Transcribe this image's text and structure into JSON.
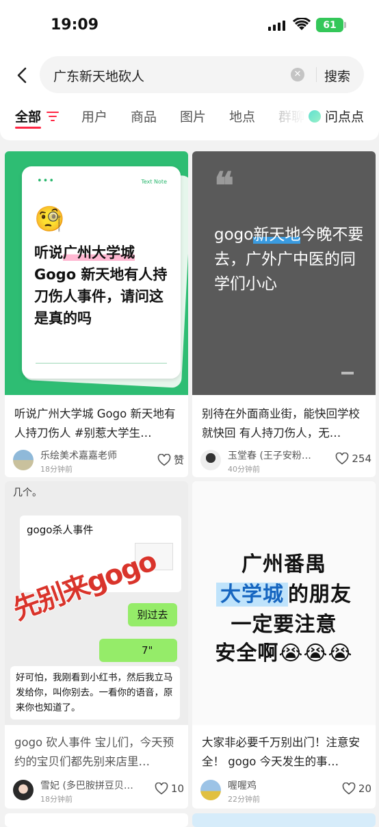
{
  "status_bar": {
    "time": "19:09",
    "battery": "61"
  },
  "search": {
    "query": "广东新天地砍人",
    "button": "搜索"
  },
  "tabs": [
    {
      "label": "全部"
    },
    {
      "label": "用户"
    },
    {
      "label": "商品"
    },
    {
      "label": "图片"
    },
    {
      "label": "地点"
    },
    {
      "label": "群聊"
    }
  ],
  "ask_button": "问点点",
  "accent_color": "#ff2442",
  "posts": [
    {
      "image": {
        "note_label": "Text Note",
        "emoji": "🧐",
        "text_before": "听说",
        "text_highlight": "广州大学城",
        "text_after": "Gogo 新天地有人持刀伤人事件，请问这是真的吗"
      },
      "title": "听说广州大学城 Gogo 新天地有人持刀伤人 #别惹大学生…",
      "author": "乐绘美术嘉嘉老师",
      "time": "18分钟前",
      "likes": "赞"
    },
    {
      "image": {
        "quote_mark": "❝",
        "text_before": "gogo",
        "text_highlight": "新天地",
        "text_after": "今晚不要去，广外广中医的同学们小心"
      },
      "title": "别待在外面商业街，能快回学校就快回 有人持刀伤人，无…",
      "author": "玉堂春 (王子安粉…",
      "time": "40分钟前",
      "likes": "254"
    },
    {
      "image": {
        "top_text": "几个。",
        "chat_title": "gogo杀人事件",
        "bubble_1": "别过去",
        "bubble_2": "7\"",
        "message": "好可怕，我刚看到小红书，然后我立马发给你，叫你别去。一看你的语音，原来你也知道了。",
        "stamp": "先别来gogo"
      },
      "title": "gogo 砍人事件 宝儿们，今天预约的宝贝们都先别来店里…",
      "author": "雪妃 (多巴胺拼豆贝…",
      "time": "18分钟前",
      "likes": "10"
    },
    {
      "image": {
        "line_1": "广州番禺",
        "line_2_highlight": "大学城",
        "line_2_rest": "的朋友",
        "line_3": "一定要注意",
        "line_4": "安全啊😭😭😭"
      },
      "title": "大家非必要千万别出门！注意安全！ gogo 今天发生的事…",
      "author": "喔喔鸡",
      "time": "22分钟前",
      "likes": "20"
    }
  ]
}
